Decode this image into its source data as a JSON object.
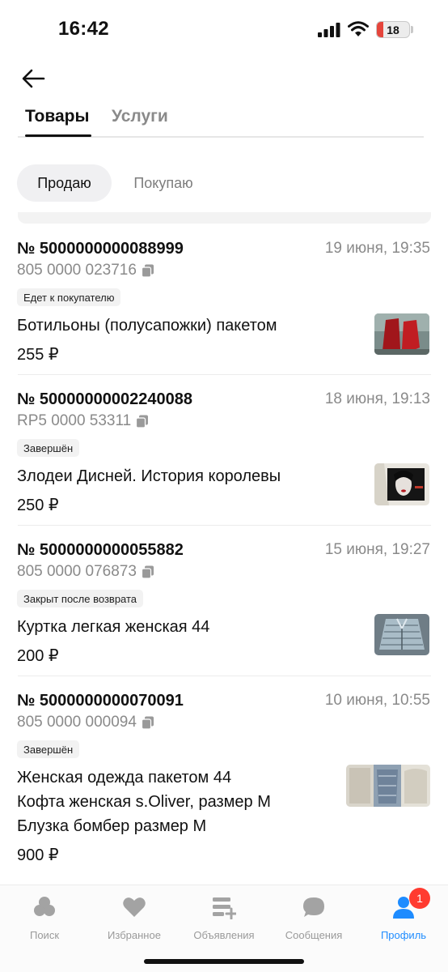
{
  "status_bar": {
    "time": "16:42",
    "battery": "18"
  },
  "tabs": {
    "goods": "Товары",
    "services": "Услуги"
  },
  "segments": {
    "sell": "Продаю",
    "buy": "Покупаю"
  },
  "orders": [
    {
      "number": "№ 5000000000088999",
      "date": "19 июня, 19:35",
      "track": "805 0000 023716",
      "status": "Едет к покупателю",
      "titles": [
        "Ботильоны (полусапожки) пакетом"
      ],
      "price": "255 ₽"
    },
    {
      "number": "№ 50000000002240088",
      "date": "18 июня, 19:13",
      "track": "RP5 0000 53311",
      "status": "Завершён",
      "titles": [
        "Злодеи Дисней. История королевы"
      ],
      "price": "250 ₽"
    },
    {
      "number": "№ 5000000000055882",
      "date": "15 июня, 19:27",
      "track": "805 0000 076873",
      "status": "Закрыт после возврата",
      "titles": [
        "Куртка легкая женская 44"
      ],
      "price": "200 ₽"
    },
    {
      "number": "№ 5000000000070091",
      "date": "10 июня, 10:55",
      "track": "805 0000 000094",
      "status": "Завершён",
      "titles": [
        "Женская одежда пакетом 44",
        "Кофта женская s.Oliver, размер M",
        "Блузка бомбер размер M"
      ],
      "price": "900 ₽"
    }
  ],
  "nav": {
    "search": "Поиск",
    "favorites": "Избранное",
    "ads": "Объявления",
    "messages": "Сообщения",
    "profile": "Профиль",
    "profile_count": "1"
  },
  "colors": {
    "accent": "#1e8cff",
    "notification": "#ff3b30",
    "muted": "#8a8a8a"
  }
}
